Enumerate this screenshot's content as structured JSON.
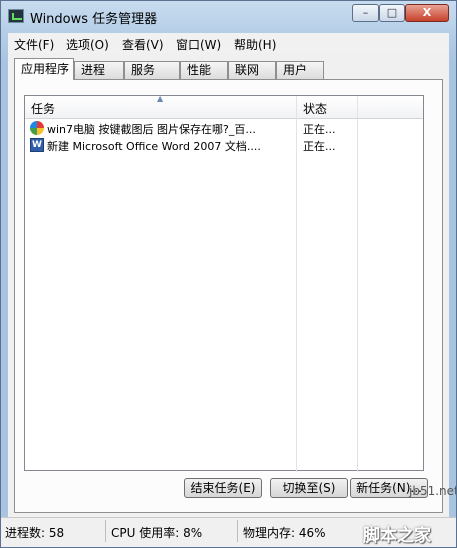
{
  "window": {
    "title": "Windows 任务管理器"
  },
  "controls": {
    "minimize": "–",
    "maximize": "□",
    "close": "X"
  },
  "menu": [
    "文件(F)",
    "选项(O)",
    "查看(V)",
    "窗口(W)",
    "帮助(H)"
  ],
  "tabs": [
    "应用程序",
    "进程",
    "服务",
    "性能",
    "联网",
    "用户"
  ],
  "list": {
    "columns": {
      "task": "任务",
      "status": "状态"
    },
    "rows": [
      {
        "icon": "pinwheel-icon",
        "name": "win7电脑 按键截图后 图片保存在哪?_百...",
        "status": "正在..."
      },
      {
        "icon": "word-document-icon",
        "name": "新建 Microsoft Office Word 2007 文档....",
        "status": "正在..."
      }
    ]
  },
  "buttons": {
    "end_task": "结束任务(E)",
    "switch_to": "切换至(S)",
    "new_task": "新任务(N)..."
  },
  "statusbar": {
    "processes": "进程数: 58",
    "cpu": "CPU 使用率: 8%",
    "memory": "物理内存: 46%"
  },
  "watermark": {
    "url": "jb51.net",
    "text": "脚本之家"
  }
}
